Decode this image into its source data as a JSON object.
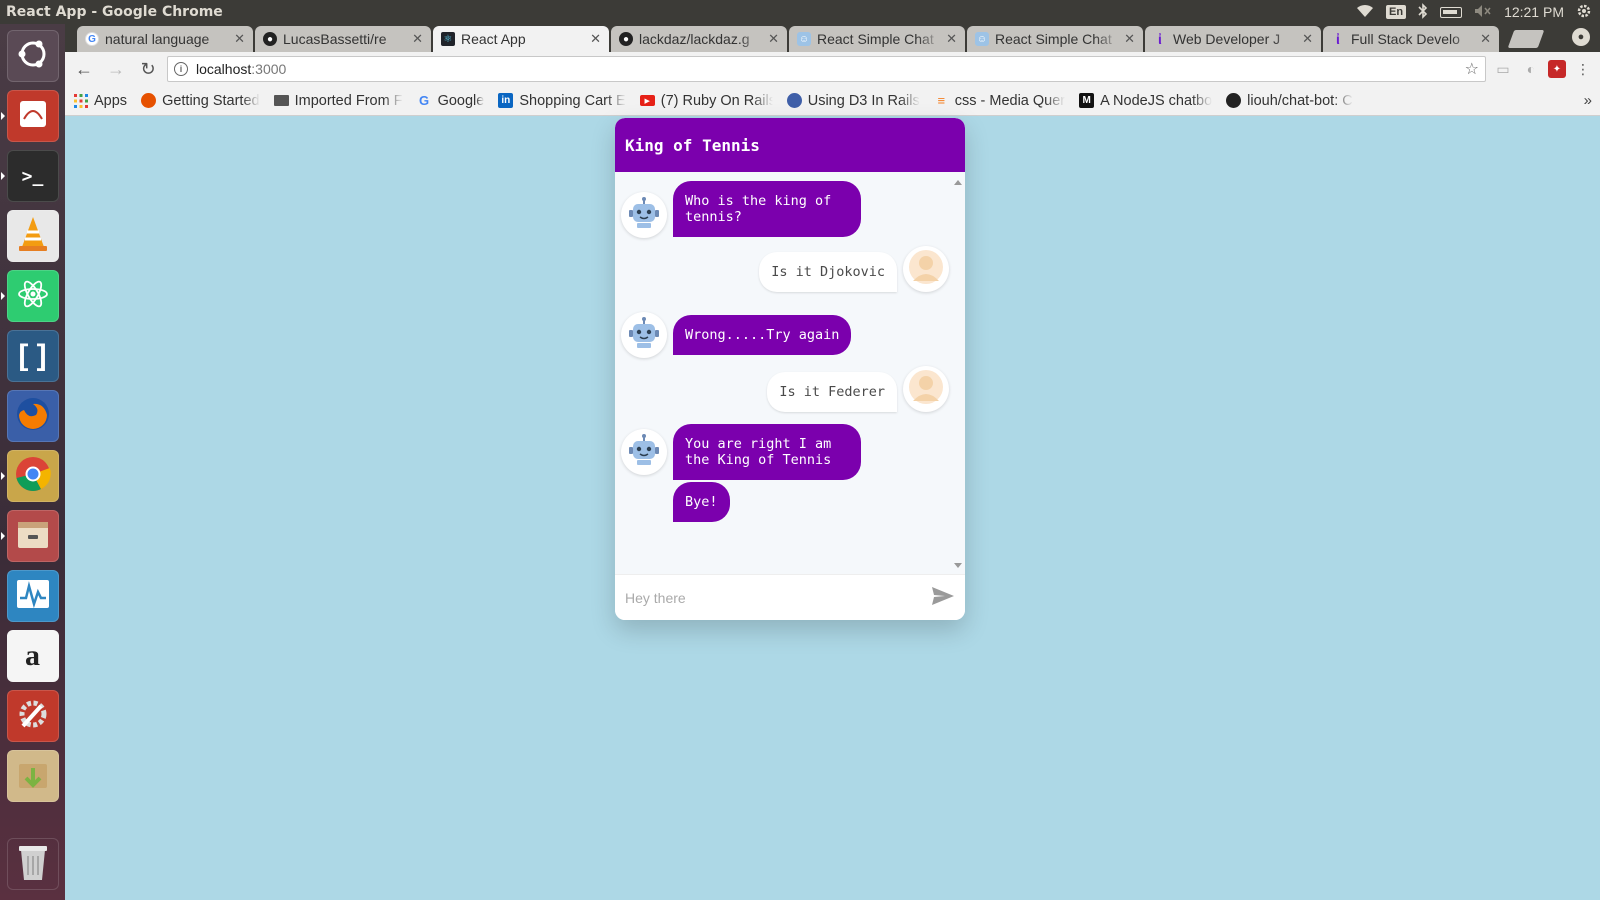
{
  "window": {
    "title": "React App - Google Chrome"
  },
  "system_tray": {
    "keyboard": "En",
    "time": "12:21 PM"
  },
  "tabs": [
    {
      "label": "natural language",
      "favicon": "google-icon",
      "active": false
    },
    {
      "label": "LucasBassetti/re",
      "favicon": "github-icon",
      "active": false
    },
    {
      "label": "React App",
      "favicon": "react-icon",
      "active": true
    },
    {
      "label": "lackdaz/lackdaz.g",
      "favicon": "github-icon",
      "active": false
    },
    {
      "label": "React Simple Chat",
      "favicon": "robot-icon",
      "active": false
    },
    {
      "label": "React Simple Chat",
      "favicon": "robot-icon",
      "active": false
    },
    {
      "label": "Web Developer J",
      "favicon": "indeed-icon",
      "active": false
    },
    {
      "label": "Full Stack Develo",
      "favicon": "indeed-icon",
      "active": false
    }
  ],
  "address": {
    "host": "localhost",
    "port": ":3000"
  },
  "bookmarks": [
    {
      "label": "Apps",
      "icon": "apps-grid-icon"
    },
    {
      "label": "Getting Started",
      "icon": "firefox-icon"
    },
    {
      "label": "Imported From F",
      "icon": "folder-icon"
    },
    {
      "label": "Google",
      "icon": "google-icon"
    },
    {
      "label": "Shopping Cart E",
      "icon": "linkedin-icon"
    },
    {
      "label": "(7) Ruby On Rails",
      "icon": "youtube-icon"
    },
    {
      "label": "Using D3 In Rails",
      "icon": "d3-icon"
    },
    {
      "label": "css - Media Quer",
      "icon": "stackoverflow-icon"
    },
    {
      "label": "A NodeJS chatbo",
      "icon": "medium-icon"
    },
    {
      "label": "liouh/chat-bot: C",
      "icon": "github-icon"
    }
  ],
  "chatbot": {
    "title": "King of Tennis",
    "messages": [
      {
        "from": "bot",
        "text": "Who is the king of tennis?"
      },
      {
        "from": "user",
        "text": "Is it Djokovic"
      },
      {
        "from": "bot",
        "text": "Wrong.....Try again"
      },
      {
        "from": "user",
        "text": "Is it Federer"
      },
      {
        "from": "bot",
        "text": "You are right I am the King of Tennis"
      },
      {
        "from": "bot",
        "text": "Bye!"
      }
    ],
    "input_placeholder": "Hey there",
    "accent": "#7b00ad"
  },
  "colors": {
    "page_background": "#add8e6",
    "ubuntu_bar": "#3c3b37"
  }
}
